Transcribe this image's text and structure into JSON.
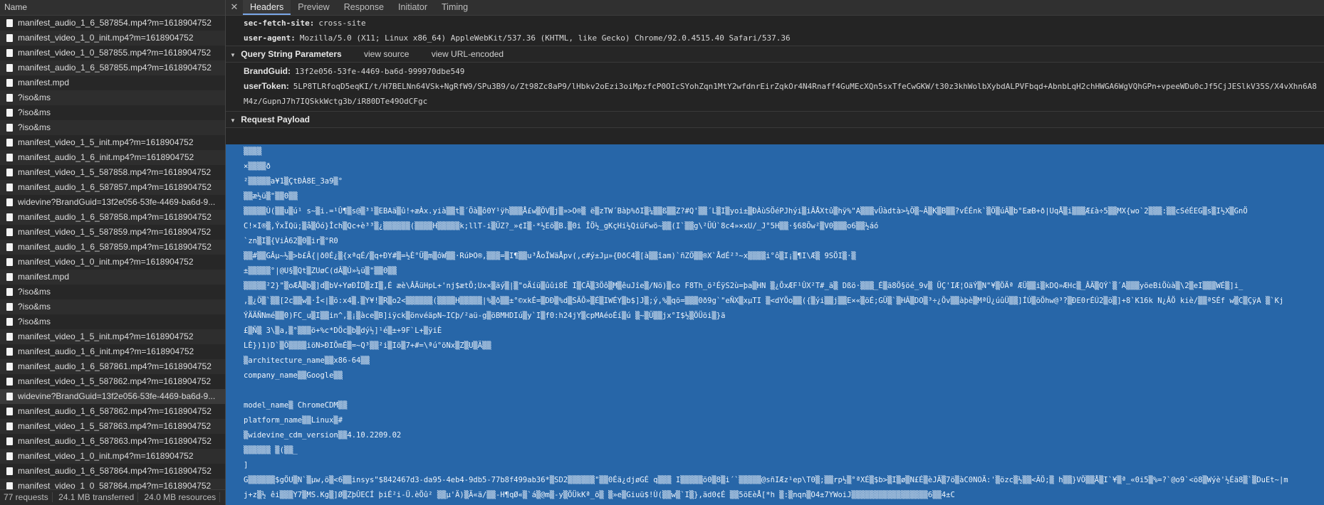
{
  "left_panel": {
    "header": "Name",
    "rows": [
      {
        "name": "manifest_audio_1_6_587854.mp4?m=1618904752",
        "selected": false
      },
      {
        "name": "manifest_video_1_0_init.mp4?m=1618904752",
        "selected": false
      },
      {
        "name": "manifest_video_1_0_587855.mp4?m=1618904752",
        "selected": false
      },
      {
        "name": "manifest_audio_1_6_587855.mp4?m=1618904752",
        "selected": false
      },
      {
        "name": "manifest.mpd",
        "selected": false
      },
      {
        "name": "?iso&ms",
        "selected": false
      },
      {
        "name": "?iso&ms",
        "selected": false
      },
      {
        "name": "?iso&ms",
        "selected": false
      },
      {
        "name": "manifest_video_1_5_init.mp4?m=1618904752",
        "selected": false
      },
      {
        "name": "manifest_audio_1_6_init.mp4?m=1618904752",
        "selected": false
      },
      {
        "name": "manifest_video_1_5_587858.mp4?m=1618904752",
        "selected": false
      },
      {
        "name": "manifest_audio_1_6_587857.mp4?m=1618904752",
        "selected": false
      },
      {
        "name": "widevine?BrandGuid=13f2e056-53fe-4469-ba6d-9...",
        "selected": false
      },
      {
        "name": "manifest_audio_1_6_587858.mp4?m=1618904752",
        "selected": false
      },
      {
        "name": "manifest_video_1_5_587859.mp4?m=1618904752",
        "selected": false
      },
      {
        "name": "manifest_audio_1_6_587859.mp4?m=1618904752",
        "selected": false
      },
      {
        "name": "manifest_video_1_0_init.mp4?m=1618904752",
        "selected": false
      },
      {
        "name": "manifest.mpd",
        "selected": false
      },
      {
        "name": "?iso&ms",
        "selected": false
      },
      {
        "name": "?iso&ms",
        "selected": false
      },
      {
        "name": "?iso&ms",
        "selected": false
      },
      {
        "name": "manifest_video_1_5_init.mp4?m=1618904752",
        "selected": false
      },
      {
        "name": "manifest_audio_1_6_init.mp4?m=1618904752",
        "selected": false
      },
      {
        "name": "manifest_audio_1_6_587861.mp4?m=1618904752",
        "selected": false
      },
      {
        "name": "manifest_video_1_5_587862.mp4?m=1618904752",
        "selected": false
      },
      {
        "name": "widevine?BrandGuid=13f2e056-53fe-4469-ba6d-9...",
        "selected": true
      },
      {
        "name": "manifest_audio_1_6_587862.mp4?m=1618904752",
        "selected": false
      },
      {
        "name": "manifest_video_1_5_587863.mp4?m=1618904752",
        "selected": false
      },
      {
        "name": "manifest_audio_1_6_587863.mp4?m=1618904752",
        "selected": false
      },
      {
        "name": "manifest_video_1_0_init.mp4?m=1618904752",
        "selected": false
      },
      {
        "name": "manifest_audio_1_6_587864.mp4?m=1618904752",
        "selected": false
      },
      {
        "name": "manifest_video_1_0_587864.mp4?m=1618904752",
        "selected": false
      }
    ],
    "footer": {
      "requests": "77 requests",
      "transferred": "24.1 MB transferred",
      "resources": "24.0 MB resources"
    }
  },
  "tabs": [
    {
      "label": "Headers",
      "active": true
    },
    {
      "label": "Preview",
      "active": false
    },
    {
      "label": "Response",
      "active": false
    },
    {
      "label": "Initiator",
      "active": false
    },
    {
      "label": "Timing",
      "active": false
    }
  ],
  "headers": [
    {
      "key": "sec-fetch-site:",
      "value": "cross-site"
    },
    {
      "key": "user-agent:",
      "value": "Mozilla/5.0 (X11; Linux x86_64) AppleWebKit/537.36 (KHTML, like Gecko) Chrome/92.0.4515.40 Safari/537.36"
    }
  ],
  "query_section": {
    "title": "Query String Parameters",
    "view_source": "view source",
    "view_encoded": "view URL-encoded",
    "params": [
      {
        "key": "BrandGuid:",
        "value": "13f2e056-53fe-4469-ba6d-999970dbe549"
      },
      {
        "key": "userToken:",
        "value": "5LP8TLRfoqD5eqKI/t/H7BELNn64VSk+NgRfW9/SPu3B9/o/Zt98Zc8aP9/lHbkv2oEzi3oiMpzfcP0OIcSYohZqn1MtY2wfdnrEirZqkOr4N4Rnaff4GuMEcXQn5sxTfeCwGKW/t30z3khWolbXybdALPVFbqd+AbnbLqH2chHWGA6WgVQhGPn+vpeeWDu0cJf5CjJESlkV35S/X4vXhn6A8",
        "cont": "M4z/GupnJ7h7IQSkkWctg3b/iR80DTe49OdCFgc"
      }
    ]
  },
  "payload_section": {
    "title": "Request Payload",
    "lines": [
      "▒▒▒▒",
      "×▒▒▒▒ð",
      "²▒▒▒▒▒a¥1▒ÇtÐÀ8E_3a9▒°",
      "▒▒æ½ü▒\"▒▒0▒▒",
      "▒▒▒▒▒Ù(▒▒u▒ú¹ s~▒i.=¹Û¶▒s@▒³¹▒EBAä▒û!+æÀx.yià▒▒t▒´Öà▒ô0Y¹ÿh▒▒▒Å£w▒ÖV▒j▒»>O®▒ ë▒zTW´Bàþ%ðI▒¼▒▒ß▒▒Z?#Q'▒▒´L▒I▒yoi±▒ÐÀùSÖéPJhýi▒iÂÅXtû▒hÿ%\"A▒▒▒vÜàdtà>¼Ö▒~Â▒K▒B▒▒?vÉÉnk`▒Ö▒úÂ▒b°EæB+ð|UqÅ▒i▒▒▒Æ£à÷5▒▒MX{wo`2▒▒▒:▒▒cSéÉEG▒s▒I½X▒GnÖ",
      "C!×I®▒,ÝxÏQü;▒å▒Óó}Îch▒Qc+è³³▒¿▒▒▒▒▒▒(▒▒▒▒H▒▒▒▒▒k;llT-i▒ÜZ?_»¢I▒·*½Eö▒B.▒0i ÎÖ½_gKçHi½QiüFwö~▒▒(I`▒▒g\\²ÜÚ`8c4»×xU/_J°5H▒▒·§68Õw²▒V0▒▒▒o6▒▒½áó",
      "`zn▒I▒{ViÀ62▒0▒ir▒°R0",
      "▒▒#▒▒GÂµ~½▒>b£Â{|ð0É¿▒{xªqÉ/▒q+ÐY#▒=½È°Ü▒m▒ôW▒▒·RúÞO®,▒▒▒=▒I¶▒▒u³ÅoÏWäÅpv(,c#ý±Jµ»{ÐðC4▒[à▒▒îam)`ñZÖ▒▒®X`ÅdÉ²³~x▒▒▒▒i°ô▒I¡▒¶I\\Æ▒  9SÖI▒·▒",
      "±▒▒▒▒▒°|@U§▒Qt▒ZUøC(dÂ▒Ú»¼ü▒\"▒▒0▒▒",
      "▒▒▒▒▒²2}\"▒oÆÅ▒b▒]d▒bV+YøÐÍD▒zI▒,É  æè\\ÂÄüHpL+'nj$ætÕ;Ux×▒äý▒|▒\"oÄíü▒ûûi8Ë I▒CÃ▒3Öô▒M▒êuJîe▒/Nö)▒co  F8Th_ö²ÉÿS2ù=þa▒HN ▒¿ÕxÆF¹ÛX²T#_ä▒  Dßö·▒▒▒_É▒ä8Ö§öé_9v▒  ÜÇ'IÆ¦OäÝ▒N\"¥▒ÖÄª  ÆÜ▒▒i▒kDQ»ÆHc▒_ÂÄ▒QÝ`▒´A▒▒▒yöeBiÖùà▒\\2▒eI▒▒▒WÉ▒]i_",
      ",▒¿Ö▒`▒▒[2c▒▒w▒·Î<|▒ö:x4▒.▒Y¥!▒R▒o2<▒▒▒▒▒▒(▒▒▒▒H▒▒▒▒▒|%▒ð▒▒±°©xkÉ=▒DÐ▒%d▒SÄÕ»▒É▒IWÉY▒b$]J▒;ý,%▒qö=▒▒▒0ð9g`\"eÑX▒xµTI ▒<dYÖo▒▒({▒ýi▒▒j▒▒E×«▒öÉ;GÜ▒`▒HÂ▒DO▒³÷¿Õv▒▒àþè▒MªÜ¿úûÜ▒▒]ÍÚ▒öÕhw@³?▒ÐE0rÉÚ2▒ö▒]+8`K16k N¿ÂÖ kiè/▒▒ªSÉf w▒C▒ÇÿA    ▒`Kj",
      "ÝÄÄÑNmé▒▒0)FC_u▒I▒▒in^,▒¡▒àce▒B]iÿck▒önvéäpN~ICþ/²aü-g▒öBMHDIú▒y`I▒f0:h24jY▒cpMAéoÉí▒ú ▒~▒Ü▒▒jx°I$½▒ÖÜöi▒}ä",
      "£▒Ñ▒    3\\▒a,▒°▒▒▒ö+%c*DÖc▒b▒dý½]¹é▒±+9F`L+▒ÿiÈ",
      "LÈ})1)D`▒Õ▒▒▒▒iöN>ÐIÕmÉ▒=~Q³▒▒²i▒Iö▒7+#=\\ªú°öNx▒Z▒U▒Ä▒▒",
      "▒architecture_name▒▒x86-64▒▒",
      "company_name▒▒Google▒▒",
      "",
      "model_name▒ ChromeCDM▒▒",
      "platform_name▒▒Linux▒#",
      "▒widevine_cdm_version▒▒4.10.2209.02",
      "▒▒▒▒▒▒ ▒(▒▒_",
      "]",
      "G▒▒▒▒▒▒$gÖU▒N`▒µw,ö▒<6▒▒insys\"$842467d3-da95-4eb4-9db5-77b8f499ab36*▒SD2▒▒▒▒▒▒\"▒▒0Éä¿djøGÉ q▒▒▒ I▒▒▒▒▒ö0▒8▒i´`▒▒▒▒▒@sñIÆz¹ep\\T0▒;▒▒rp½▒°ªXÉ▒$b>▒I▒ø▒N£É▒èJÄ▒7ö▒àC0NOÄ:'▒özc▒½▒▒<ÄÖ;▒ h▒▒}VÖ▒▒Å▒I`¥▒ª_«0i5▒%=?`@o9`<ö8▒Wýè'½Éä8▒`▒DuEt~|m",
      "j+z▒½ êi▒▒▒Y7▒MS.Kg▒]Ø▒ZþÛECÍ   þiÉ²i-Ü.èÖû²     ▒▒µ'Ä)▒Ä«ä/▒▒-H¶qØ«▒`á▒@m▒-y▒ÖÜkKª_ö▒ ▒»e▒Giuü$!Ù(▒▒w▒`I▒},äd0¢É ▒▒5öEèÅ[*h ▒:▒nqn▒O4±7YWoiJ▒▒▒▒▒▒▒▒▒▒▒▒▒▒▒▒▒6▒▒4±C"
    ]
  },
  "colors": {
    "selection": "#2766a8",
    "active_tab_underline": "#7aa7e8"
  }
}
